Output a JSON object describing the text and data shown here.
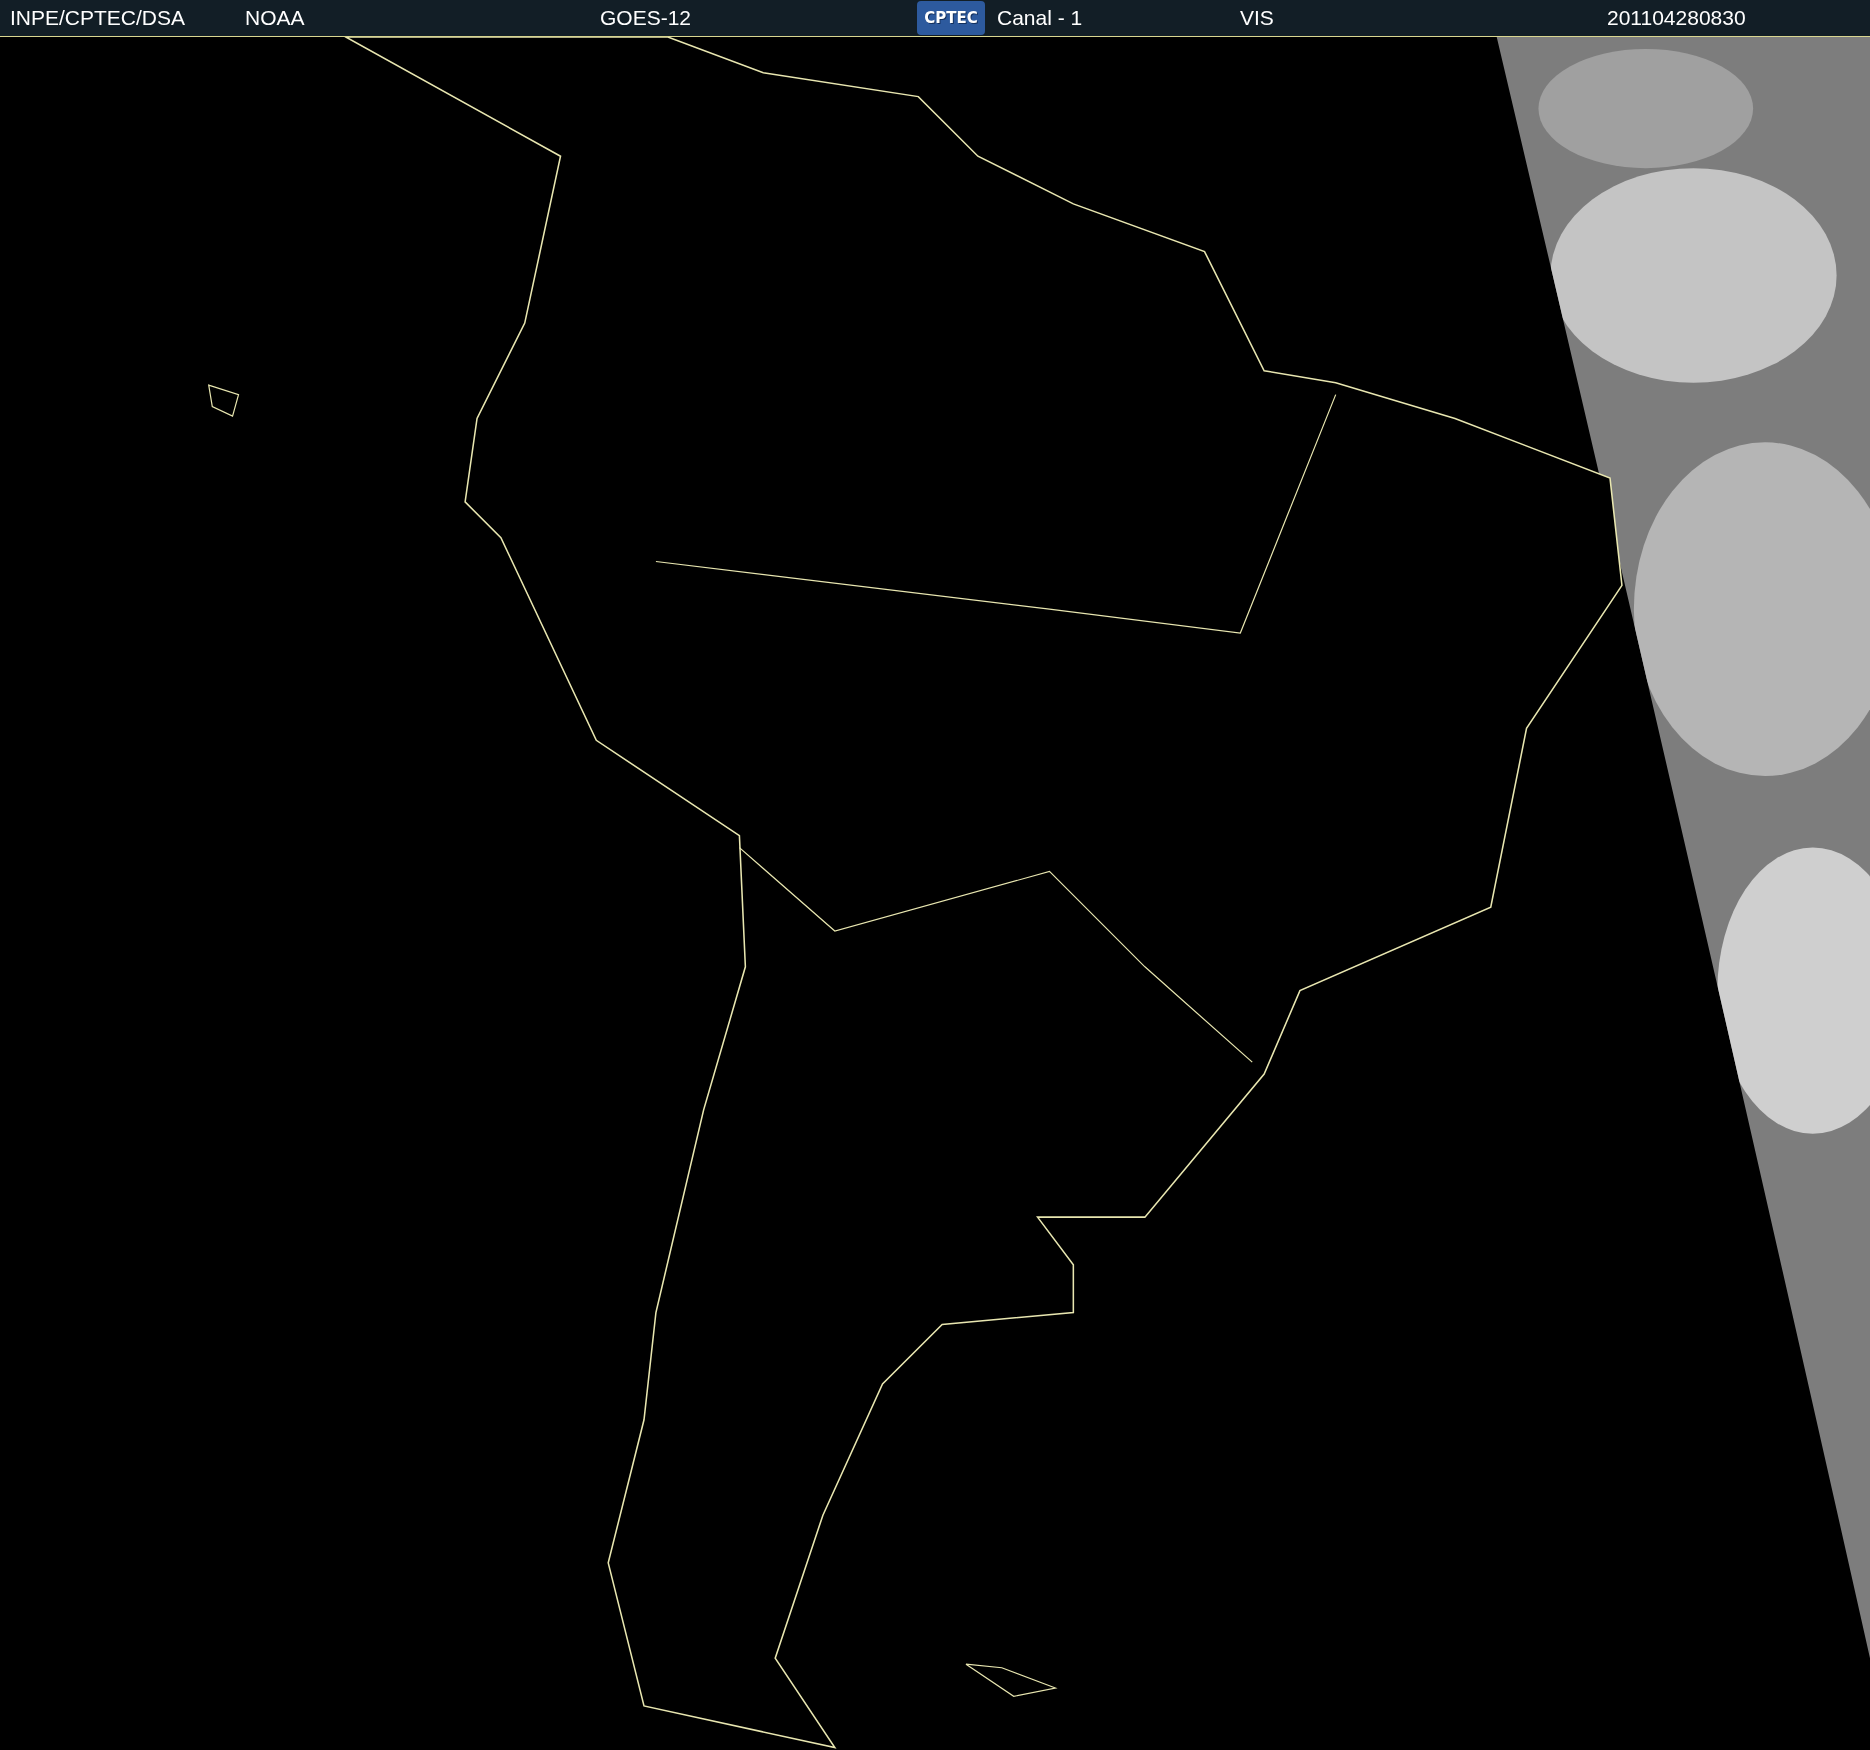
{
  "header": {
    "items": [
      {
        "kind": "text",
        "text": "INPE/CPTEC/DSA"
      },
      {
        "kind": "text",
        "text": "NOAA"
      },
      {
        "kind": "text",
        "text": "GOES-12"
      },
      {
        "kind": "logo",
        "text": "CPTEC"
      },
      {
        "kind": "text",
        "text": "Canal - 1"
      },
      {
        "kind": "text",
        "text": "VIS"
      },
      {
        "kind": "text",
        "text": "201104280830"
      }
    ]
  }
}
